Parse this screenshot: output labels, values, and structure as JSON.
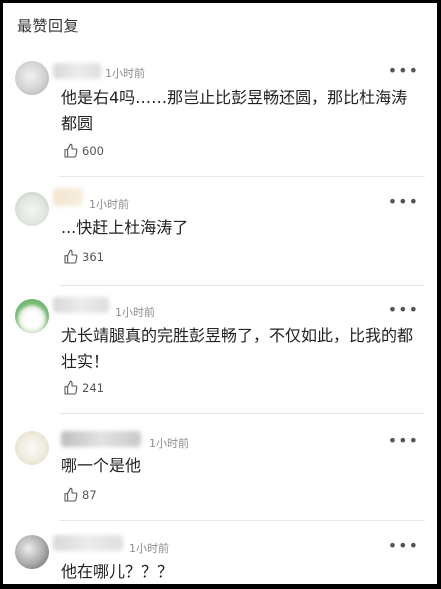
{
  "section_title": "最赞回复",
  "comments": [
    {
      "time": "1小时前",
      "text": "他是右4吗……那岂止比彭昱畅还圆，那比杜海涛都圆",
      "likes": "600"
    },
    {
      "time": "1小时前",
      "text": "...快赶上杜海涛了",
      "likes": "361"
    },
    {
      "time": "1小时前",
      "text": "尤长靖腿真的完胜彭昱畅了，不仅如此，比我的都壮实！",
      "likes": "241"
    },
    {
      "time": "1小时前",
      "text": "哪一个是他",
      "likes": "87"
    },
    {
      "time": "1小时前",
      "text": "他在哪儿？？？",
      "likes": ""
    }
  ],
  "more_label": "•••"
}
